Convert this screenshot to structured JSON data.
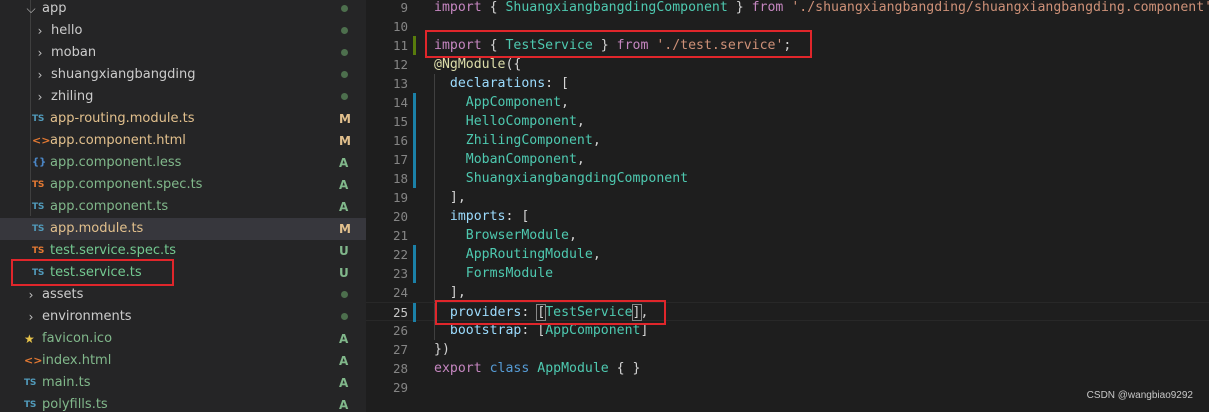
{
  "explorer": {
    "items": [
      {
        "type": "folder",
        "label": "app",
        "depth": 0,
        "expanded": true,
        "status": "dot"
      },
      {
        "type": "folder",
        "label": "hello",
        "depth": 1,
        "expanded": false,
        "status": "dot"
      },
      {
        "type": "folder",
        "label": "moban",
        "depth": 1,
        "expanded": false,
        "status": "dot"
      },
      {
        "type": "folder",
        "label": "shuangxiangbangding",
        "depth": 1,
        "expanded": false,
        "status": "dot"
      },
      {
        "type": "folder",
        "label": "zhiling",
        "depth": 1,
        "expanded": false,
        "status": "dot"
      },
      {
        "type": "ts",
        "icon": "TS",
        "label": "app-routing.module.ts",
        "depth": 1,
        "status": "M"
      },
      {
        "type": "html",
        "icon": "<>",
        "label": "app.component.html",
        "depth": 1,
        "status": "M"
      },
      {
        "type": "less",
        "icon": "{}",
        "label": "app.component.less",
        "depth": 1,
        "status": "A"
      },
      {
        "type": "ts-spec",
        "icon": "TS",
        "label": "app.component.spec.ts",
        "depth": 1,
        "status": "A"
      },
      {
        "type": "ts",
        "icon": "TS",
        "label": "app.component.ts",
        "depth": 1,
        "status": "A"
      },
      {
        "type": "ts",
        "icon": "TS",
        "label": "app.module.ts",
        "depth": 1,
        "status": "M",
        "selected": true
      },
      {
        "type": "ts-spec",
        "icon": "TS",
        "label": "test.service.spec.ts",
        "depth": 1,
        "status": "U"
      },
      {
        "type": "ts",
        "icon": "TS",
        "label": "test.service.ts",
        "depth": 1,
        "status": "U",
        "boxed": true
      },
      {
        "type": "folder",
        "label": "assets",
        "depth": 0,
        "expanded": false,
        "status": "dot"
      },
      {
        "type": "folder",
        "label": "environments",
        "depth": 0,
        "expanded": false,
        "status": "dot"
      },
      {
        "type": "favicon",
        "icon": "★",
        "label": "favicon.ico",
        "depth": 0,
        "status": "A"
      },
      {
        "type": "html",
        "icon": "<>",
        "label": "index.html",
        "depth": 0,
        "status": "A"
      },
      {
        "type": "ts",
        "icon": "TS",
        "label": "main.ts",
        "depth": 0,
        "status": "A"
      },
      {
        "type": "ts",
        "icon": "TS",
        "label": "polyfills.ts",
        "depth": 0,
        "status": "A"
      }
    ]
  },
  "editor": {
    "active_line": 25,
    "lines": [
      {
        "n": 9,
        "gutter": "",
        "tokens": [
          [
            "keyword",
            "import"
          ],
          [
            "punct",
            " { "
          ],
          [
            "class",
            "ShuangxiangbangdingComponent"
          ],
          [
            "punct",
            " } "
          ],
          [
            "keyword",
            "from"
          ],
          [
            "punct",
            " "
          ],
          [
            "string",
            "'./shuangxiangbangding/shuangxiangbangding.component'"
          ],
          [
            "punct",
            ";"
          ]
        ]
      },
      {
        "n": 10,
        "gutter": "",
        "tokens": []
      },
      {
        "n": 11,
        "gutter": "add",
        "tokens": [
          [
            "keyword",
            "import"
          ],
          [
            "punct",
            " { "
          ],
          [
            "class",
            "TestService"
          ],
          [
            "punct",
            " } "
          ],
          [
            "keyword",
            "from"
          ],
          [
            "punct",
            " "
          ],
          [
            "string",
            "'./test.service'"
          ],
          [
            "punct",
            ";"
          ]
        ]
      },
      {
        "n": 12,
        "gutter": "",
        "tokens": [
          [
            "deco",
            "@NgModule"
          ],
          [
            "punct",
            "({"
          ]
        ]
      },
      {
        "n": 13,
        "gutter": "",
        "tokens": [
          [
            "punct",
            "  "
          ],
          [
            "prop",
            "declarations"
          ],
          [
            "punct",
            ": ["
          ]
        ]
      },
      {
        "n": 14,
        "gutter": "mod",
        "tokens": [
          [
            "punct",
            "    "
          ],
          [
            "class",
            "AppComponent"
          ],
          [
            "punct",
            ","
          ]
        ]
      },
      {
        "n": 15,
        "gutter": "mod",
        "tokens": [
          [
            "punct",
            "    "
          ],
          [
            "class",
            "HelloComponent"
          ],
          [
            "punct",
            ","
          ]
        ]
      },
      {
        "n": 16,
        "gutter": "mod",
        "tokens": [
          [
            "punct",
            "    "
          ],
          [
            "class",
            "ZhilingComponent"
          ],
          [
            "punct",
            ","
          ]
        ]
      },
      {
        "n": 17,
        "gutter": "mod",
        "tokens": [
          [
            "punct",
            "    "
          ],
          [
            "class",
            "MobanComponent"
          ],
          [
            "punct",
            ","
          ]
        ]
      },
      {
        "n": 18,
        "gutter": "mod",
        "tokens": [
          [
            "punct",
            "    "
          ],
          [
            "class",
            "ShuangxiangbangdingComponent"
          ]
        ]
      },
      {
        "n": 19,
        "gutter": "",
        "tokens": [
          [
            "punct",
            "  ],"
          ]
        ]
      },
      {
        "n": 20,
        "gutter": "",
        "tokens": [
          [
            "punct",
            "  "
          ],
          [
            "prop",
            "imports"
          ],
          [
            "punct",
            ": ["
          ]
        ]
      },
      {
        "n": 21,
        "gutter": "",
        "tokens": [
          [
            "punct",
            "    "
          ],
          [
            "class",
            "BrowserModule"
          ],
          [
            "punct",
            ","
          ]
        ]
      },
      {
        "n": 22,
        "gutter": "mod",
        "tokens": [
          [
            "punct",
            "    "
          ],
          [
            "class",
            "AppRoutingModule"
          ],
          [
            "punct",
            ","
          ]
        ]
      },
      {
        "n": 23,
        "gutter": "mod",
        "tokens": [
          [
            "punct",
            "    "
          ],
          [
            "class",
            "FormsModule"
          ]
        ]
      },
      {
        "n": 24,
        "gutter": "",
        "tokens": [
          [
            "punct",
            "  ],"
          ]
        ]
      },
      {
        "n": 25,
        "gutter": "mod",
        "tokens": [
          [
            "punct",
            "  "
          ],
          [
            "prop",
            "providers"
          ],
          [
            "punct",
            ": "
          ],
          [
            "bracket",
            "["
          ],
          [
            "class",
            "TestService"
          ],
          [
            "bracket",
            "]"
          ],
          [
            "punct",
            ","
          ]
        ]
      },
      {
        "n": 26,
        "gutter": "",
        "tokens": [
          [
            "punct",
            "  "
          ],
          [
            "prop",
            "bootstrap"
          ],
          [
            "punct",
            ": ["
          ],
          [
            "class",
            "AppComponent"
          ],
          [
            "punct",
            "]"
          ]
        ]
      },
      {
        "n": 27,
        "gutter": "",
        "tokens": [
          [
            "punct",
            "})"
          ]
        ]
      },
      {
        "n": 28,
        "gutter": "",
        "tokens": [
          [
            "keyword",
            "export"
          ],
          [
            "punct",
            " "
          ],
          [
            "storage",
            "class"
          ],
          [
            "punct",
            " "
          ],
          [
            "class",
            "AppModule"
          ],
          [
            "punct",
            " { }"
          ]
        ]
      },
      {
        "n": 29,
        "gutter": "",
        "tokens": []
      }
    ]
  },
  "watermark": "CSDN @wangbiao9292",
  "colors": {
    "keyword": "#c586c0",
    "class": "#4ec9b0",
    "string": "#ce9178",
    "prop": "#9cdcfe",
    "highlight_box": "#e0262b",
    "modified": "#e2c08d",
    "added": "#81b88b"
  }
}
